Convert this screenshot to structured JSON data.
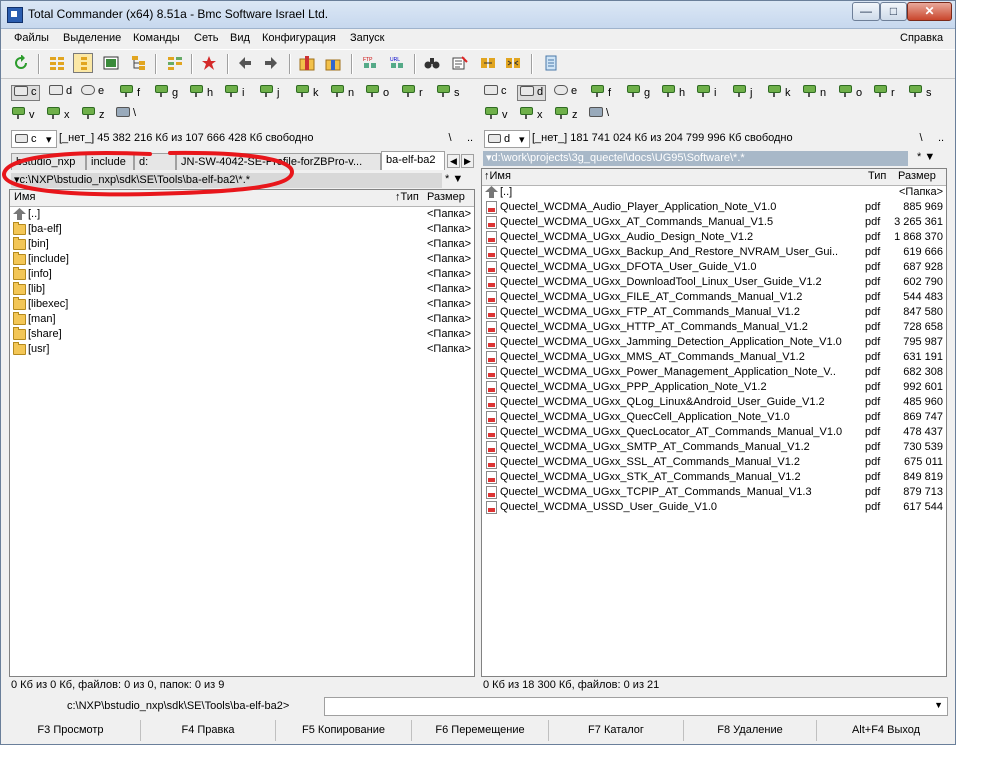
{
  "window": {
    "title": "Total Commander (x64) 8.51a - Bmc Software Israel Ltd.",
    "controls": {
      "minimize": "—",
      "maximize": "□",
      "close": "✕"
    }
  },
  "menu": {
    "items": [
      "Файлы",
      "Выделение",
      "Команды",
      "Сеть",
      "Вид",
      "Конфигурация",
      "Запуск"
    ],
    "help": "Справка"
  },
  "toolbar": {
    "icons": [
      "refresh-icon",
      "brief-view-icon",
      "full-view-icon",
      "thumbnail-view-icon",
      "tree-view-icon",
      "invert-selection-icon",
      "back-icon",
      "forward-icon",
      "pack-icon",
      "unpack-icon",
      "ftp-connect-icon",
      "url-connect-icon",
      "find-icon",
      "multi-rename-icon",
      "compare-dirs-icon",
      "notepad-icon"
    ]
  },
  "left": {
    "drives": [
      "c",
      "d",
      "e",
      "f",
      "g",
      "h",
      "i",
      "j",
      "k",
      "n",
      "o",
      "r",
      "s",
      "v",
      "x",
      "z",
      "\\"
    ],
    "selected_drive": "c",
    "drive_combo": "c",
    "drive_info": "[_нет_]  45 382 216 Кб из 107 666 428 Кб свободно",
    "root_btn": "\\",
    "up_btn": "..",
    "tabs": [
      "bstudio_nxp",
      "include",
      "d:",
      "JN-SW-4042-SE-Profile-forZBPro-v...",
      "ba-elf-ba2"
    ],
    "path": "c:\\NXP\\bstudio_nxp\\sdk\\SE\\Tools\\ba-elf-ba2\\*.*",
    "filter": "* ▼",
    "columns": {
      "name": "Имя",
      "ext": "↑Тип",
      "size": "Размер"
    },
    "rows": [
      {
        "name": "[..]",
        "ext": "",
        "size": "<Папка>",
        "icon": "up"
      },
      {
        "name": "[ba-elf]",
        "ext": "",
        "size": "<Папка>",
        "icon": "folder"
      },
      {
        "name": "[bin]",
        "ext": "",
        "size": "<Папка>",
        "icon": "folder"
      },
      {
        "name": "[include]",
        "ext": "",
        "size": "<Папка>",
        "icon": "folder"
      },
      {
        "name": "[info]",
        "ext": "",
        "size": "<Папка>",
        "icon": "folder"
      },
      {
        "name": "[lib]",
        "ext": "",
        "size": "<Папка>",
        "icon": "folder"
      },
      {
        "name": "[libexec]",
        "ext": "",
        "size": "<Папка>",
        "icon": "folder"
      },
      {
        "name": "[man]",
        "ext": "",
        "size": "<Папка>",
        "icon": "folder"
      },
      {
        "name": "[share]",
        "ext": "",
        "size": "<Папка>",
        "icon": "folder"
      },
      {
        "name": "[usr]",
        "ext": "",
        "size": "<Папка>",
        "icon": "folder"
      }
    ],
    "status": "0 Кб из 0 Кб, файлов: 0 из 0, папок: 0 из 9"
  },
  "right": {
    "drives": [
      "c",
      "d",
      "e",
      "f",
      "g",
      "h",
      "i",
      "j",
      "k",
      "n",
      "o",
      "r",
      "s",
      "v",
      "x",
      "z",
      "\\"
    ],
    "selected_drive": "d",
    "drive_combo": "d",
    "drive_info": "[_нет_]  181 741 024 Кб из 204 799 996 Кб свободно",
    "root_btn": "\\",
    "up_btn": "..",
    "path": "d:\\work\\projects\\3g_quectel\\docs\\UG95\\Software\\*.*",
    "filter": "* ▼",
    "columns": {
      "name": "↑Имя",
      "ext": "Тип",
      "size": "Размер"
    },
    "rows": [
      {
        "name": "[..]",
        "ext": "",
        "size": "<Папка>",
        "icon": "up"
      },
      {
        "name": "Quectel_WCDMA_Audio_Player_Application_Note_V1.0",
        "ext": "pdf",
        "size": "885 969",
        "icon": "pdf"
      },
      {
        "name": "Quectel_WCDMA_UGxx_AT_Commands_Manual_V1.5",
        "ext": "pdf",
        "size": "3 265 361",
        "icon": "pdf"
      },
      {
        "name": "Quectel_WCDMA_UGxx_Audio_Design_Note_V1.2",
        "ext": "pdf",
        "size": "1 868 370",
        "icon": "pdf"
      },
      {
        "name": "Quectel_WCDMA_UGxx_Backup_And_Restore_NVRAM_User_Gui..",
        "ext": "pdf",
        "size": "619 666",
        "icon": "pdf"
      },
      {
        "name": "Quectel_WCDMA_UGxx_DFOTA_User_Guide_V1.0",
        "ext": "pdf",
        "size": "687 928",
        "icon": "pdf"
      },
      {
        "name": "Quectel_WCDMA_UGxx_DownloadTool_Linux_User_Guide_V1.2",
        "ext": "pdf",
        "size": "602 790",
        "icon": "pdf"
      },
      {
        "name": "Quectel_WCDMA_UGxx_FILE_AT_Commands_Manual_V1.2",
        "ext": "pdf",
        "size": "544 483",
        "icon": "pdf"
      },
      {
        "name": "Quectel_WCDMA_UGxx_FTP_AT_Commands_Manual_V1.2",
        "ext": "pdf",
        "size": "847 580",
        "icon": "pdf"
      },
      {
        "name": "Quectel_WCDMA_UGxx_HTTP_AT_Commands_Manual_V1.2",
        "ext": "pdf",
        "size": "728 658",
        "icon": "pdf"
      },
      {
        "name": "Quectel_WCDMA_UGxx_Jamming_Detection_Application_Note_V1.0",
        "ext": "pdf",
        "size": "795 987",
        "icon": "pdf"
      },
      {
        "name": "Quectel_WCDMA_UGxx_MMS_AT_Commands_Manual_V1.2",
        "ext": "pdf",
        "size": "631 191",
        "icon": "pdf"
      },
      {
        "name": "Quectel_WCDMA_UGxx_Power_Management_Application_Note_V..",
        "ext": "pdf",
        "size": "682 308",
        "icon": "pdf"
      },
      {
        "name": "Quectel_WCDMA_UGxx_PPP_Application_Note_V1.2",
        "ext": "pdf",
        "size": "992 601",
        "icon": "pdf"
      },
      {
        "name": "Quectel_WCDMA_UGxx_QLog_Linux&Android_User_Guide_V1.2",
        "ext": "pdf",
        "size": "485 960",
        "icon": "pdf"
      },
      {
        "name": "Quectel_WCDMA_UGxx_QuecCell_Application_Note_V1.0",
        "ext": "pdf",
        "size": "869 747",
        "icon": "pdf"
      },
      {
        "name": "Quectel_WCDMA_UGxx_QuecLocator_AT_Commands_Manual_V1.0",
        "ext": "pdf",
        "size": "478 437",
        "icon": "pdf"
      },
      {
        "name": "Quectel_WCDMA_UGxx_SMTP_AT_Commands_Manual_V1.2",
        "ext": "pdf",
        "size": "730 539",
        "icon": "pdf"
      },
      {
        "name": "Quectel_WCDMA_UGxx_SSL_AT_Commands_Manual_V1.2",
        "ext": "pdf",
        "size": "675 011",
        "icon": "pdf"
      },
      {
        "name": "Quectel_WCDMA_UGxx_STK_AT_Commands_Manual_V1.2",
        "ext": "pdf",
        "size": "849 819",
        "icon": "pdf"
      },
      {
        "name": "Quectel_WCDMA_UGxx_TCPIP_AT_Commands_Manual_V1.3",
        "ext": "pdf",
        "size": "879 713",
        "icon": "pdf"
      },
      {
        "name": "Quectel_WCDMA_USSD_User_Guide_V1.0",
        "ext": "pdf",
        "size": "617 544",
        "icon": "pdf"
      }
    ],
    "status": "0 Кб из 18 300 Кб, файлов: 0 из 21"
  },
  "cmdline": {
    "prompt": "c:\\NXP\\bstudio_nxp\\sdk\\SE\\Tools\\ba-elf-ba2>",
    "value": ""
  },
  "fkeys": [
    "F3 Просмотр",
    "F4 Правка",
    "F5 Копирование",
    "F6 Перемещение",
    "F7 Каталог",
    "F8 Удаление",
    "Alt+F4 Выход"
  ],
  "colors": {
    "annotation": "#e8161b",
    "path_active": "#d8d8d8",
    "path_inactive": "#a8b8c8",
    "folder": "#f3c656"
  }
}
